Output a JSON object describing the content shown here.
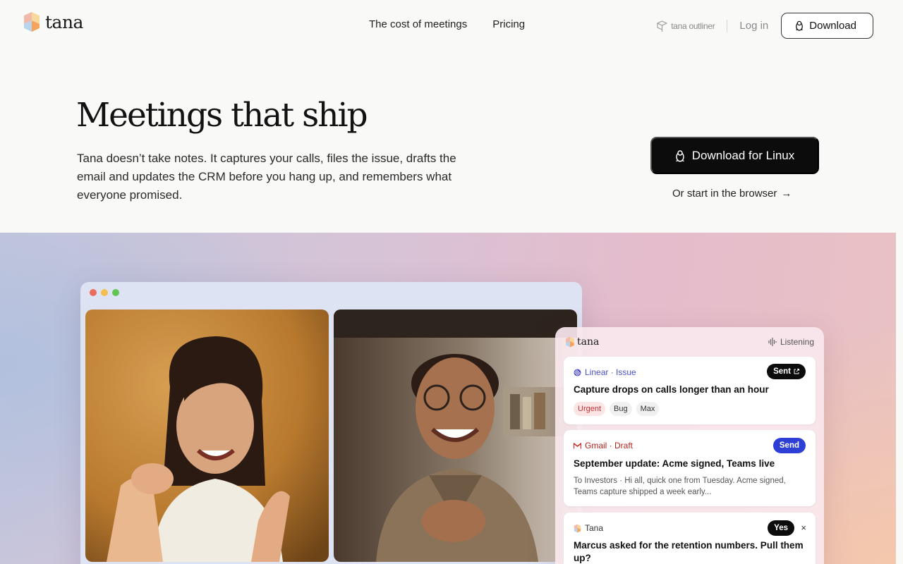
{
  "nav": {
    "logo_text": "tana",
    "links": [
      "The cost of meetings",
      "Pricing"
    ],
    "outliner_label": "tana outliner",
    "login_label": "Log in",
    "download_label": "Download"
  },
  "hero": {
    "title": "Meetings that ship",
    "subtitle": "Tana doesn’t take notes. It captures your calls, files the issue, drafts the email and updates the CRM before you hang up, and remembers what everyone promised.",
    "cta_label": "Download for Linux",
    "browser_label": "Or start in the browser",
    "browser_arrow": "→"
  },
  "colors": {
    "accent_dark": "#0c0c0c",
    "linear": "#4b50c7",
    "gmail": "#b3261e",
    "send_pill": "#2d3fd4",
    "urgent_bg": "#fbe4e4"
  },
  "panel": {
    "brand": "tana",
    "status": "Listening",
    "cards": [
      {
        "source": "Linear · Issue",
        "action": "Sent",
        "title": "Capture drops on calls longer than an hour",
        "tags": [
          "Urgent",
          "Bug",
          "Max"
        ]
      },
      {
        "source": "Gmail · Draft",
        "action": "Send",
        "title": "September update: Acme signed, Teams live",
        "body": "To Investors · Hi all, quick one from Tuesday. Acme signed, Teams capture shipped a week early..."
      },
      {
        "source": "Tana",
        "action": "Yes",
        "dismiss": "×",
        "title": "Marcus asked for the retention numbers. Pull them up?"
      }
    ]
  },
  "icons": {
    "logo": "tana-logo-icon",
    "linux": "linux-penguin-icon",
    "outliner": "tana-outliner-icon",
    "listening": "waveform-icon",
    "external": "external-link-icon"
  }
}
